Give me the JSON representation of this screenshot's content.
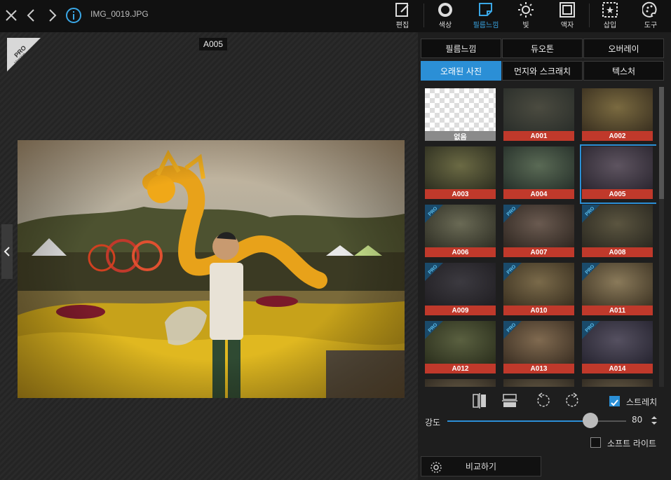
{
  "header": {
    "filename": "IMG_0019.JPG",
    "tools": [
      {
        "label": "편집",
        "icon": "edit-icon"
      },
      {
        "label": "색상",
        "icon": "color-icon"
      },
      {
        "label": "필름느낌",
        "icon": "film-icon"
      },
      {
        "label": "빛",
        "icon": "light-icon"
      },
      {
        "label": "액자",
        "icon": "frame-icon"
      },
      {
        "label": "삽입",
        "icon": "insert-icon"
      },
      {
        "label": "도구",
        "icon": "palette-icon"
      }
    ],
    "active_tool": "필름느낌"
  },
  "canvas": {
    "badge_top": "PRO",
    "badge_bottom": "Version",
    "selected_label": "A005"
  },
  "panel": {
    "tabs_row1": [
      "필름느낌",
      "듀오톤",
      "오버레이"
    ],
    "tabs_row2": [
      "오래된 사진",
      "먼지와 스크래치",
      "텍스처"
    ],
    "active_tab": "오래된 사진",
    "thumbnails": [
      {
        "label": "없음",
        "pro": false
      },
      {
        "label": "A001",
        "pro": false
      },
      {
        "label": "A002",
        "pro": false
      },
      {
        "label": "A003",
        "pro": false
      },
      {
        "label": "A004",
        "pro": false
      },
      {
        "label": "A005",
        "pro": false,
        "selected": true
      },
      {
        "label": "A006",
        "pro": true
      },
      {
        "label": "A007",
        "pro": true
      },
      {
        "label": "A008",
        "pro": true
      },
      {
        "label": "A009",
        "pro": true
      },
      {
        "label": "A010",
        "pro": true
      },
      {
        "label": "A011",
        "pro": true
      },
      {
        "label": "A012",
        "pro": true
      },
      {
        "label": "A013",
        "pro": true
      },
      {
        "label": "A014",
        "pro": true
      }
    ],
    "pro_badge": "PRO",
    "stretch_label": "스트레치",
    "stretch_checked": true,
    "intensity_label": "강도",
    "intensity_value": "80",
    "intensity_fraction": 0.8,
    "softlight_label": "소프트 라이트",
    "softlight_checked": false,
    "compare_label": "비교하기"
  },
  "colors": {
    "accent": "#2b8fd6",
    "caption_red": "#c0392b"
  }
}
